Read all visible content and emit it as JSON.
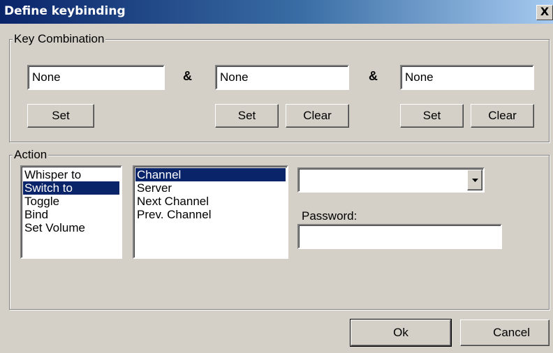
{
  "window": {
    "title": "Define keybinding",
    "close_glyph": "X"
  },
  "key_combination": {
    "legend": "Key Combination",
    "separator": "&",
    "key1": {
      "value": "None",
      "set_label": "Set"
    },
    "key2": {
      "value": "None",
      "set_label": "Set",
      "clear_label": "Clear"
    },
    "key3": {
      "value": "None",
      "set_label": "Set",
      "clear_label": "Clear"
    }
  },
  "action": {
    "legend": "Action",
    "action_list": [
      {
        "label": "Whisper to",
        "selected": false
      },
      {
        "label": "Switch to",
        "selected": true
      },
      {
        "label": "Toggle",
        "selected": false
      },
      {
        "label": "Bind",
        "selected": false
      },
      {
        "label": "Set Volume",
        "selected": false
      }
    ],
    "target_list": [
      {
        "label": "Channel",
        "selected": true
      },
      {
        "label": "Server",
        "selected": false
      },
      {
        "label": "Next Channel",
        "selected": false
      },
      {
        "label": "Prev. Channel",
        "selected": false
      }
    ],
    "channel_dropdown": {
      "value": "",
      "icon": "chevron-down-icon"
    },
    "password_label": "Password:",
    "password_value": ""
  },
  "footer": {
    "ok_label": "Ok",
    "cancel_label": "Cancel"
  },
  "colors": {
    "titlebar_start": "#0a246a",
    "titlebar_end": "#a6caf0",
    "selection": "#0a246a",
    "face": "#d4d0c8"
  }
}
